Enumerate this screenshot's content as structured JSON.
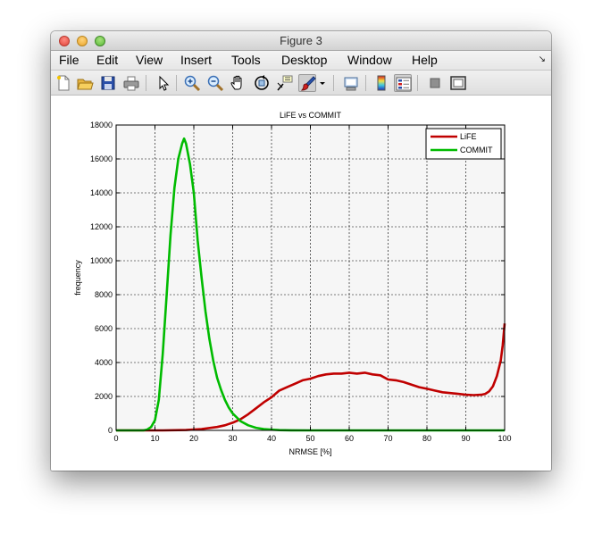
{
  "window": {
    "title": "Figure 3"
  },
  "menu": {
    "items": [
      "File",
      "Edit",
      "View",
      "Insert",
      "Tools",
      "Desktop",
      "Window",
      "Help"
    ]
  },
  "toolbar": {
    "icons": [
      "new-figure-icon",
      "open-file-icon",
      "save-icon",
      "print-icon",
      "edit-plot-arrow-icon",
      "zoom-in-icon",
      "zoom-out-icon",
      "pan-hand-icon",
      "rotate-3d-icon",
      "data-cursor-icon",
      "brush-icon",
      "brush-dropdown-icon",
      "link-plot-icon",
      "colorbar-icon",
      "legend-icon",
      "hide-plot-tools-icon",
      "show-plot-tools-icon"
    ]
  },
  "chart_data": {
    "type": "line",
    "title": "LiFE vs COMMIT",
    "xlabel": "NRMSE [%]",
    "ylabel": "frequency",
    "xlim": [
      0,
      100
    ],
    "ylim": [
      0,
      18000
    ],
    "xticks": [
      "0",
      "10",
      "20",
      "30",
      "40",
      "50",
      "60",
      "70",
      "80",
      "90",
      "100"
    ],
    "yticks": [
      "0",
      "2000",
      "4000",
      "6000",
      "8000",
      "10000",
      "12000",
      "14000",
      "16000",
      "18000"
    ],
    "grid": true,
    "legend_position": "top-right",
    "colors": {
      "LiFE": "#c00000",
      "COMMIT": "#00bb00",
      "axes_background": "#f6f6f6"
    },
    "series": [
      {
        "name": "LiFE",
        "x": [
          0,
          12,
          18,
          22,
          26,
          28,
          30,
          32,
          34,
          36,
          38,
          40,
          42,
          44,
          46,
          48,
          50,
          52,
          54,
          56,
          58,
          60,
          62,
          64,
          66,
          68,
          70,
          72,
          74,
          76,
          78,
          80,
          82,
          84,
          86,
          88,
          90,
          92,
          94,
          95,
          96,
          97,
          98,
          99,
          99.5,
          100
        ],
        "y": [
          0,
          0,
          20,
          80,
          200,
          300,
          450,
          650,
          950,
          1300,
          1650,
          1950,
          2350,
          2550,
          2750,
          2950,
          3050,
          3200,
          3300,
          3350,
          3350,
          3400,
          3350,
          3400,
          3300,
          3250,
          3000,
          2950,
          2850,
          2700,
          2550,
          2450,
          2350,
          2250,
          2200,
          2150,
          2100,
          2080,
          2100,
          2150,
          2300,
          2600,
          3200,
          4100,
          5000,
          6300
        ]
      },
      {
        "name": "COMMIT",
        "x": [
          0,
          7,
          8,
          9,
          10,
          11,
          12,
          13,
          14,
          15,
          16,
          17,
          17.5,
          18,
          19,
          20,
          21,
          22,
          23,
          24,
          25,
          26,
          27,
          28,
          29,
          30,
          32,
          34,
          36,
          38,
          40,
          42,
          45,
          50,
          100
        ],
        "y": [
          0,
          0,
          50,
          200,
          600,
          1800,
          4500,
          8000,
          11500,
          14300,
          16000,
          16900,
          17200,
          16900,
          15700,
          14000,
          11200,
          9000,
          7000,
          5400,
          4100,
          3100,
          2400,
          1800,
          1350,
          1000,
          550,
          300,
          150,
          80,
          40,
          15,
          5,
          0,
          0
        ]
      }
    ]
  }
}
